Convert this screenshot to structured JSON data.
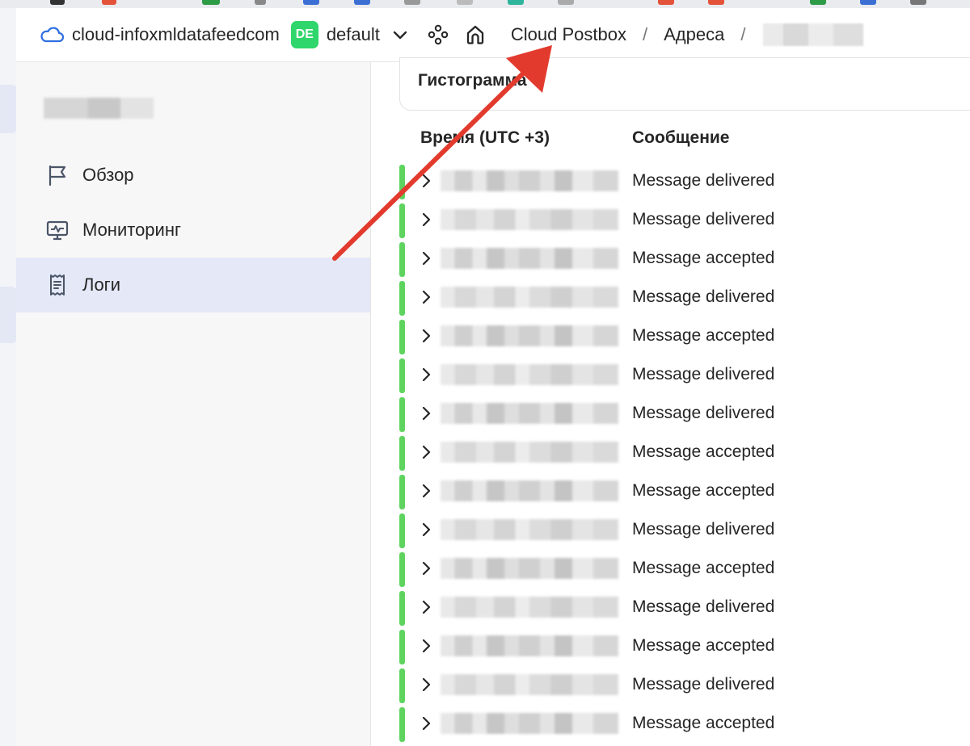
{
  "header": {
    "cloud_name": "cloud-infoxmldatafeedcom",
    "folder_badge": "DE",
    "folder_name": "default",
    "breadcrumb": [
      "Cloud Postbox",
      "Адреса"
    ],
    "separator": "/"
  },
  "sidebar": {
    "items": [
      {
        "label": "Обзор",
        "icon": "flag-icon",
        "active": false
      },
      {
        "label": "Мониторинг",
        "icon": "monitor-icon",
        "active": false
      },
      {
        "label": "Логи",
        "icon": "receipt-icon",
        "active": true
      }
    ]
  },
  "main": {
    "histogram_title": "Гистограмма",
    "columns": {
      "time": "Время (UTC +3)",
      "message": "Сообщение"
    },
    "rows": [
      {
        "message": "Message delivered"
      },
      {
        "message": "Message delivered"
      },
      {
        "message": "Message accepted"
      },
      {
        "message": "Message delivered"
      },
      {
        "message": "Message accepted"
      },
      {
        "message": "Message delivered"
      },
      {
        "message": "Message delivered"
      },
      {
        "message": "Message accepted"
      },
      {
        "message": "Message accepted"
      },
      {
        "message": "Message delivered"
      },
      {
        "message": "Message accepted"
      },
      {
        "message": "Message delivered"
      },
      {
        "message": "Message accepted"
      },
      {
        "message": "Message delivered"
      },
      {
        "message": "Message accepted"
      }
    ]
  },
  "colors": {
    "status_bar": "#5ed45f",
    "badge": "#2fd66b",
    "active_nav": "#e4e8f7",
    "annotation_arrow": "#e23b2e"
  }
}
